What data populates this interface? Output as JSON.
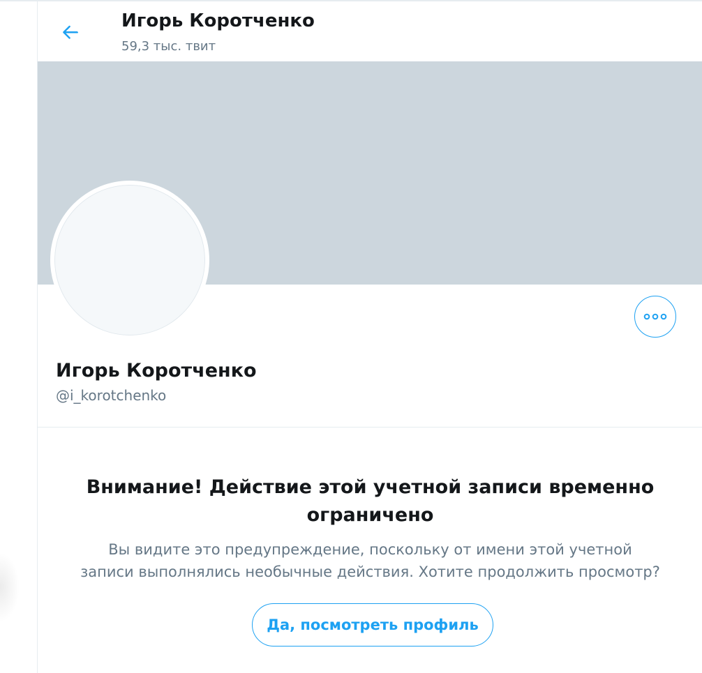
{
  "colors": {
    "accent": "#1da1f2",
    "banner": "#ccd6dd",
    "text_primary": "#14171a",
    "text_secondary": "#657786",
    "border": "#e6ecf0"
  },
  "header": {
    "back_icon": "arrow-left-icon",
    "title": "Игорь Коротченко",
    "subtitle": "59,3 тыс. твит"
  },
  "profile": {
    "name": "Игорь Коротченко",
    "handle": "@i_korotchenko",
    "more_icon": "more-dots-icon"
  },
  "warning": {
    "title": "Внимание! Действие этой учетной записи временно ограничено",
    "text": "Вы видите это предупреждение, поскольку от имени этой учетной записи выполнялись необычные действия. Хотите продолжить просмотр?",
    "button_label": "Да, посмотреть профиль"
  }
}
